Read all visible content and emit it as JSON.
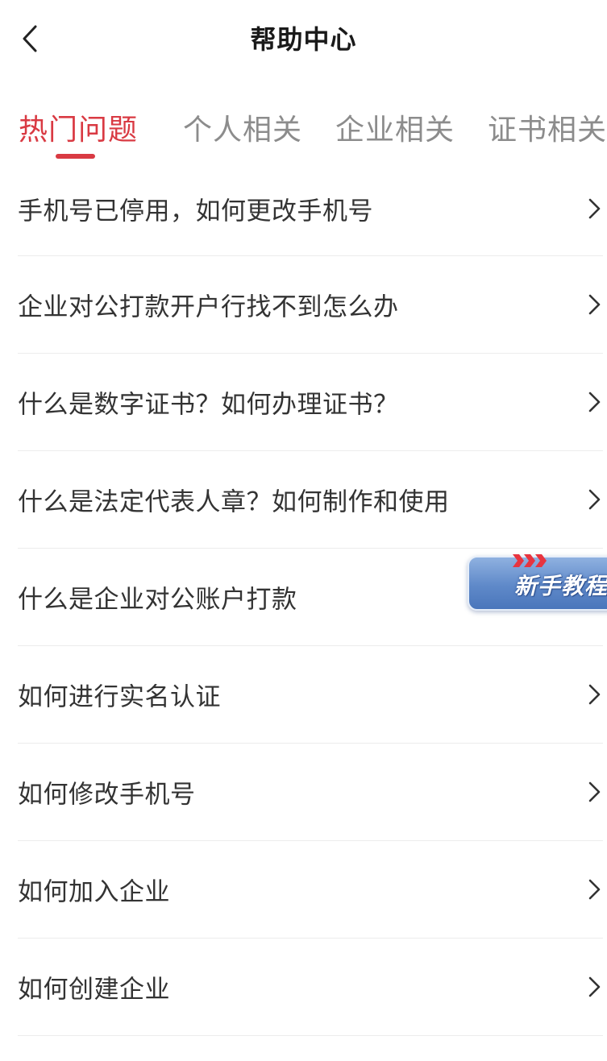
{
  "header": {
    "title": "帮助中心"
  },
  "tabs": [
    {
      "label": "热门问题",
      "active": true
    },
    {
      "label": "个人相关",
      "active": false
    },
    {
      "label": "企业相关",
      "active": false
    },
    {
      "label": "证书相关",
      "active": false
    }
  ],
  "faq": [
    {
      "label": "手机号已停用，如何更改手机号"
    },
    {
      "label": "企业对公打款开户行找不到怎么办"
    },
    {
      "label": "什么是数字证书？如何办理证书？"
    },
    {
      "label": "什么是法定代表人章？如何制作和使用"
    },
    {
      "label": "什么是企业对公账户打款"
    },
    {
      "label": "如何进行实名认证"
    },
    {
      "label": "如何修改手机号"
    },
    {
      "label": "如何加入企业"
    },
    {
      "label": "如何创建企业"
    }
  ],
  "tutorial": {
    "label": "新手教程"
  },
  "colors": {
    "accent": "#d93a43",
    "tab_inactive": "#8c8c8c",
    "text": "#333333",
    "divider": "#ececec"
  },
  "icons": {
    "back": "chevron-left-icon",
    "row": "chevron-right-icon"
  }
}
